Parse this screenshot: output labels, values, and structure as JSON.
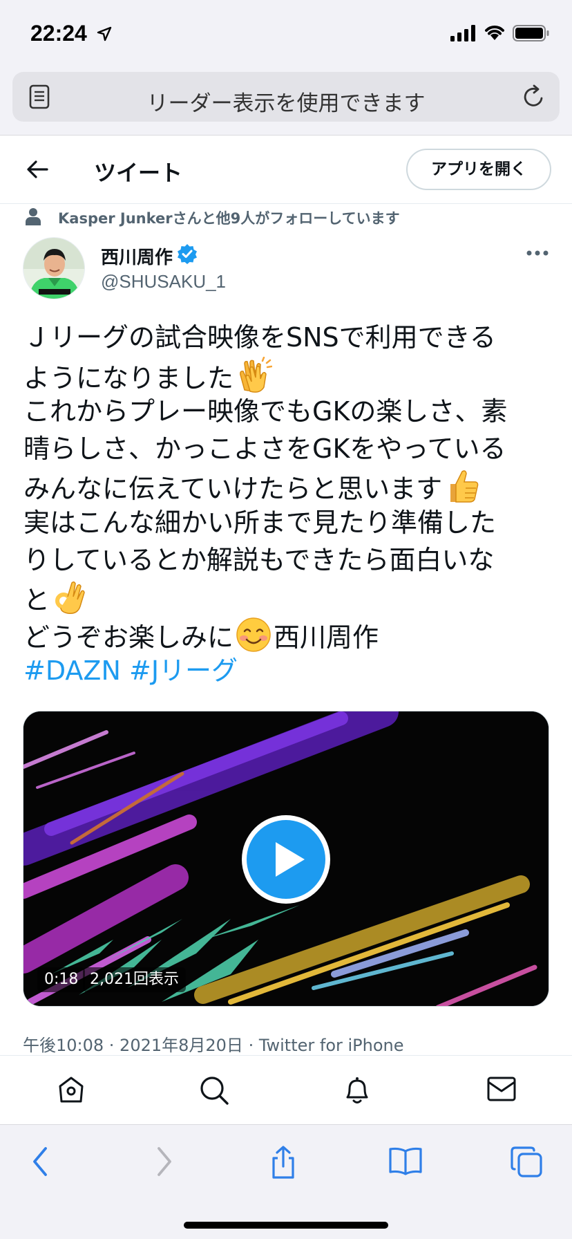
{
  "status": {
    "time": "22:24"
  },
  "browser": {
    "url_text": "リーダー表示を使用できます"
  },
  "header": {
    "title": "ツイート",
    "open_app": "アプリを開く"
  },
  "context": {
    "follow_text": "Kasper Junkerさんと他9人がフォローしています"
  },
  "author": {
    "name": "西川周作",
    "handle": "@SHUSAKU_1"
  },
  "tweet": {
    "lines": [
      "Ｊリーグの試合映像をSNSで利用できる",
      "ようになりました",
      "これからプレー映像でもGKの楽しさ、素",
      "晴らしさ、かっこよさをGKをやっている",
      "みんなに伝えていけたらと思います",
      "実はこんな細かい所まで見たり準備した",
      "りしているとか解説もできたら面白いな",
      "と",
      "どうぞお楽しみに",
      "西川周作"
    ],
    "hashtags": [
      "#DAZN",
      "#Jリーグ"
    ],
    "emojis": [
      "clapping-hands",
      "thumbs-up",
      "ok-hand",
      "smiling-face"
    ]
  },
  "video": {
    "duration": "0:18",
    "views": "2,021回表示"
  },
  "meta": {
    "timestamp": "午後10:08 · 2021年8月20日 · Twitter for iPhone"
  },
  "twitter_nav": [
    "home-icon",
    "search-icon",
    "bell-icon",
    "mail-icon"
  ],
  "safari_toolbar": [
    "back-icon",
    "forward-icon",
    "share-icon",
    "bookmarks-icon",
    "tabs-icon"
  ],
  "colors": {
    "link": "#1d9bf0",
    "verified": "#1d9bf0",
    "secondary_text": "#536471"
  }
}
